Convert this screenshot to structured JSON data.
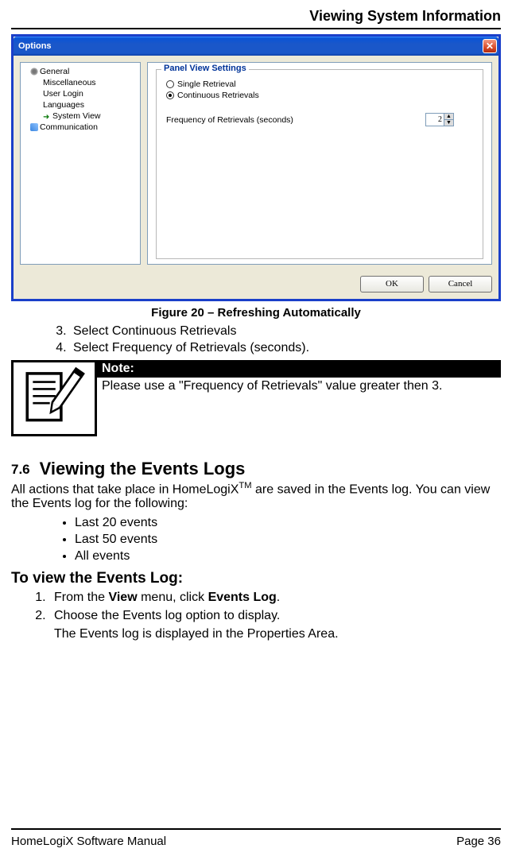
{
  "header": {
    "title": "Viewing System Information"
  },
  "dialog": {
    "title": "Options",
    "close_label": "✕",
    "tree": {
      "items": [
        {
          "label": "General",
          "indent": 1,
          "icon": "gear"
        },
        {
          "label": "Miscellaneous",
          "indent": 2,
          "icon": null
        },
        {
          "label": "User Login",
          "indent": 2,
          "icon": null
        },
        {
          "label": "Languages",
          "indent": 2,
          "icon": null
        },
        {
          "label": "System View",
          "indent": 2,
          "icon": "arrow"
        },
        {
          "label": "Communication",
          "indent": 1,
          "icon": "comm"
        }
      ]
    },
    "fieldset": {
      "legend": "Panel View Settings",
      "radio1": "Single Retrieval",
      "radio2": "Continuous Retrievals",
      "selected": 2,
      "freq_label": "Frequency of Retrievals (seconds)",
      "freq_value": "2"
    },
    "ok_label": "OK",
    "cancel_label": "Cancel"
  },
  "figure_caption": "Figure 20 – Refreshing Automatically",
  "steps_a": [
    "Select Continuous Retrievals",
    "Select Frequency of Retrievals (seconds)."
  ],
  "note": {
    "header": "Note:",
    "body": "Please use a \"Frequency of Retrievals\" value greater then 3."
  },
  "section76": {
    "number": "7.6",
    "heading": "Viewing the Events Logs",
    "intro_a": "All actions that take place in HomeLogiX",
    "intro_tm": "TM",
    "intro_b": " are saved in the Events log. You can view the Events log for the following:",
    "bullets": [
      "Last 20 events",
      "Last 50 events",
      "All events"
    ],
    "subheading": "To view the Events Log:",
    "step1_a": "From the ",
    "step1_b": "View",
    "step1_c": " menu, click ",
    "step1_d": "Events Log",
    "step1_e": ".",
    "step2": "Choose the Events log option to display.",
    "step2_follow": "The Events log is displayed in the Properties Area."
  },
  "footer": {
    "left": "HomeLogiX Software Manual",
    "right": "Page 36"
  }
}
